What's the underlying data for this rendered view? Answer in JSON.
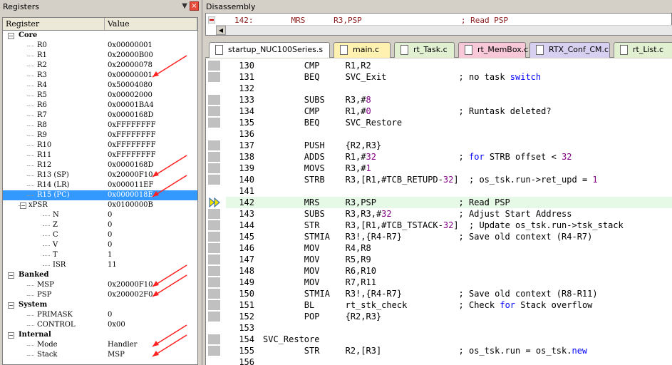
{
  "registers_pane": {
    "title": "Registers",
    "pin_icon": "pin-icon",
    "close_icon": "close-icon",
    "col_register": "Register",
    "col_value": "Value",
    "groups": [
      {
        "label": "Core",
        "items": [
          {
            "name": "R0",
            "value": "0x00000001"
          },
          {
            "name": "R1",
            "value": "0x20000B00"
          },
          {
            "name": "R2",
            "value": "0x20000078"
          },
          {
            "name": "R3",
            "value": "0x00000001"
          },
          {
            "name": "R4",
            "value": "0x50004080"
          },
          {
            "name": "R5",
            "value": "0x00002000"
          },
          {
            "name": "R6",
            "value": "0x00001BA4"
          },
          {
            "name": "R7",
            "value": "0x0000168D"
          },
          {
            "name": "R8",
            "value": "0xFFFFFFFF"
          },
          {
            "name": "R9",
            "value": "0xFFFFFFFF"
          },
          {
            "name": "R10",
            "value": "0xFFFFFFFF"
          },
          {
            "name": "R11",
            "value": "0xFFFFFFFF"
          },
          {
            "name": "R12",
            "value": "0x0000168D"
          },
          {
            "name": "R13 (SP)",
            "value": "0x20000F10"
          },
          {
            "name": "R14 (LR)",
            "value": "0x000011EF"
          },
          {
            "name": "R15 (PC)",
            "value": "0x0000018E",
            "selected": true
          },
          {
            "name": "xPSR",
            "value": "0x0100000B",
            "expandable": true
          }
        ]
      },
      {
        "xpsr_items": [
          {
            "name": "N",
            "value": "0"
          },
          {
            "name": "Z",
            "value": "0"
          },
          {
            "name": "C",
            "value": "0"
          },
          {
            "name": "V",
            "value": "0"
          },
          {
            "name": "T",
            "value": "1"
          },
          {
            "name": "ISR",
            "value": "11"
          }
        ]
      },
      {
        "label": "Banked",
        "items": [
          {
            "name": "MSP",
            "value": "0x20000F10"
          },
          {
            "name": "PSP",
            "value": "0x200002F0"
          }
        ]
      },
      {
        "label": "System",
        "items": [
          {
            "name": "PRIMASK",
            "value": "0"
          },
          {
            "name": "CONTROL",
            "value": "0x00"
          }
        ]
      },
      {
        "label": "Internal",
        "items": [
          {
            "name": "Mode",
            "value": "Handler"
          },
          {
            "name": "Stack",
            "value": "MSP"
          }
        ]
      }
    ],
    "arrow_color": "#ff2020"
  },
  "disassembly_pane": {
    "title": "Disassembly",
    "top_line": "142:        MRS      R3,PSP                     ; Read PSP",
    "tabs": [
      {
        "label": "startup_NUC100Series.s",
        "color": "#ffffff"
      },
      {
        "label": "main.c",
        "color": "#fff2b0"
      },
      {
        "label": "rt_Task.c",
        "color": "#e0f0d0"
      },
      {
        "label": "rt_MemBox.c",
        "color": "#f8c8d8"
      },
      {
        "label": "RTX_Conf_CM.c",
        "color": "#d8d0f0"
      },
      {
        "label": "rt_List.c",
        "color": "#e0f0d0"
      }
    ],
    "lines": [
      {
        "num": "130",
        "text": "        CMP     R1,R2"
      },
      {
        "num": "131",
        "text": "        BEQ     SVC_Exit              ; no task switch"
      },
      {
        "num": "132",
        "text": ""
      },
      {
        "num": "133",
        "text": "        SUBS    R3,#8"
      },
      {
        "num": "134",
        "text": "        CMP     R1,#0                 ; Runtask deleted?"
      },
      {
        "num": "135",
        "text": "        BEQ     SVC_Restore"
      },
      {
        "num": "136",
        "text": ""
      },
      {
        "num": "137",
        "text": "        PUSH    {R2,R3}"
      },
      {
        "num": "138",
        "text": "        ADDS    R1,#32                ; for STRB offset < 32"
      },
      {
        "num": "139",
        "text": "        MOVS    R3,#1"
      },
      {
        "num": "140",
        "text": "        STRB    R3,[R1,#TCB_RETUPD-32]  ; os_tsk.run->ret_upd = 1"
      },
      {
        "num": "141",
        "text": ""
      },
      {
        "num": "142",
        "text": "        MRS     R3,PSP                ; Read PSP",
        "current": true
      },
      {
        "num": "143",
        "text": "        SUBS    R3,R3,#32             ; Adjust Start Address"
      },
      {
        "num": "144",
        "text": "        STR     R3,[R1,#TCB_TSTACK-32]  ; Update os_tsk.run->tsk_stack"
      },
      {
        "num": "145",
        "text": "        STMIA   R3!,{R4-R7}           ; Save old context (R4-R7)"
      },
      {
        "num": "146",
        "text": "        MOV     R4,R8"
      },
      {
        "num": "147",
        "text": "        MOV     R5,R9"
      },
      {
        "num": "148",
        "text": "        MOV     R6,R10"
      },
      {
        "num": "149",
        "text": "        MOV     R7,R11"
      },
      {
        "num": "150",
        "text": "        STMIA   R3!,{R4-R7}           ; Save old context (R8-R11)"
      },
      {
        "num": "151",
        "text": "        BL      rt_stk_check          ; Check for Stack overflow"
      },
      {
        "num": "152",
        "text": "        POP     {R2,R3}"
      },
      {
        "num": "153",
        "text": ""
      },
      {
        "num": "154",
        "text": "SVC_Restore"
      },
      {
        "num": "155",
        "text": "        STR     R2,[R3]               ; os_tsk.run = os_tsk.new"
      },
      {
        "num": "156",
        "text": ""
      }
    ]
  }
}
